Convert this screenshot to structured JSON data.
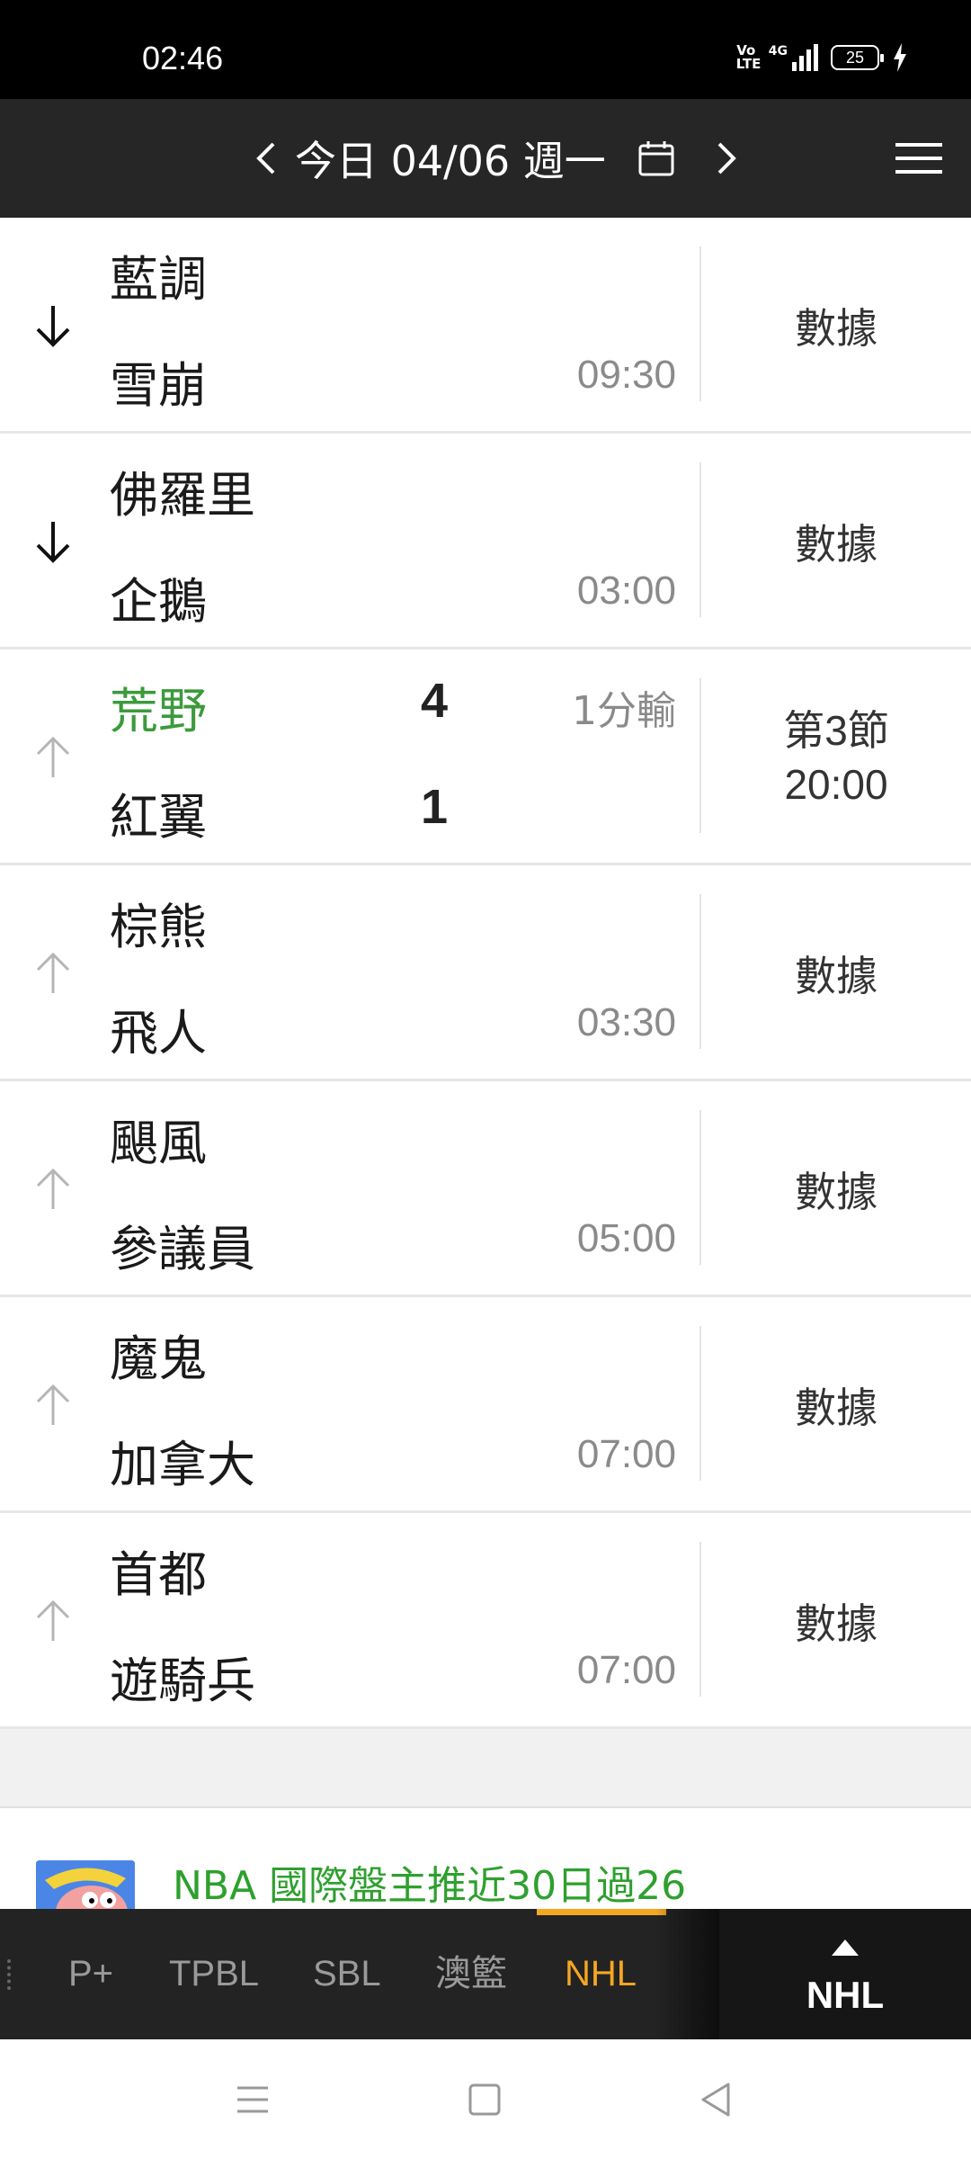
{
  "status_bar": {
    "time": "02:46",
    "volte": "Vo\nLTE",
    "network": "4G",
    "battery": "25"
  },
  "header": {
    "date_label": "今日 04/06 週一",
    "icons": [
      "chevron-left-icon",
      "calendar-icon",
      "chevron-right-icon",
      "hamburger-menu-icon"
    ]
  },
  "games": [
    {
      "home": "藍調",
      "away": "雪崩",
      "home_score": "",
      "away_score": "",
      "time": "09:30",
      "handicap": "",
      "right": "數據",
      "period": "",
      "clock": "",
      "arrow": "down",
      "home_winning": false
    },
    {
      "home": "佛羅里",
      "away": "企鵝",
      "home_score": "",
      "away_score": "",
      "time": "03:00",
      "handicap": "",
      "right": "數據",
      "period": "",
      "clock": "",
      "arrow": "down",
      "home_winning": false
    },
    {
      "home": "荒野",
      "away": "紅翼",
      "home_score": "4",
      "away_score": "1",
      "time": "",
      "handicap": "1分輸",
      "right": "",
      "period": "第3節",
      "clock": "20:00",
      "arrow": "up",
      "home_winning": true
    },
    {
      "home": "棕熊",
      "away": "飛人",
      "home_score": "",
      "away_score": "",
      "time": "03:30",
      "handicap": "",
      "right": "數據",
      "period": "",
      "clock": "",
      "arrow": "up",
      "home_winning": false
    },
    {
      "home": "颶風",
      "away": "參議員",
      "home_score": "",
      "away_score": "",
      "time": "05:00",
      "handicap": "",
      "right": "數據",
      "period": "",
      "clock": "",
      "arrow": "up",
      "home_winning": false
    },
    {
      "home": "魔鬼",
      "away": "加拿大",
      "home_score": "",
      "away_score": "",
      "time": "07:00",
      "handicap": "",
      "right": "數據",
      "period": "",
      "clock": "",
      "arrow": "up",
      "home_winning": false
    },
    {
      "home": "首都",
      "away": "遊騎兵",
      "home_score": "",
      "away_score": "",
      "time": "07:00",
      "handicap": "",
      "right": "數據",
      "period": "",
      "clock": "",
      "arrow": "up",
      "home_winning": false
    }
  ],
  "ad": {
    "text": "NBA 國際盤主推近30日過26"
  },
  "league_tabs": {
    "items": [
      "P+",
      "TPBL",
      "SBL",
      "澳籃",
      "NHL"
    ],
    "active": "NHL",
    "current": "NHL"
  },
  "colors": {
    "header_bg": "#262626",
    "winning_team": "#3c9a3c",
    "active_tab": "#f5a623",
    "ad_text": "#2ea02e"
  }
}
